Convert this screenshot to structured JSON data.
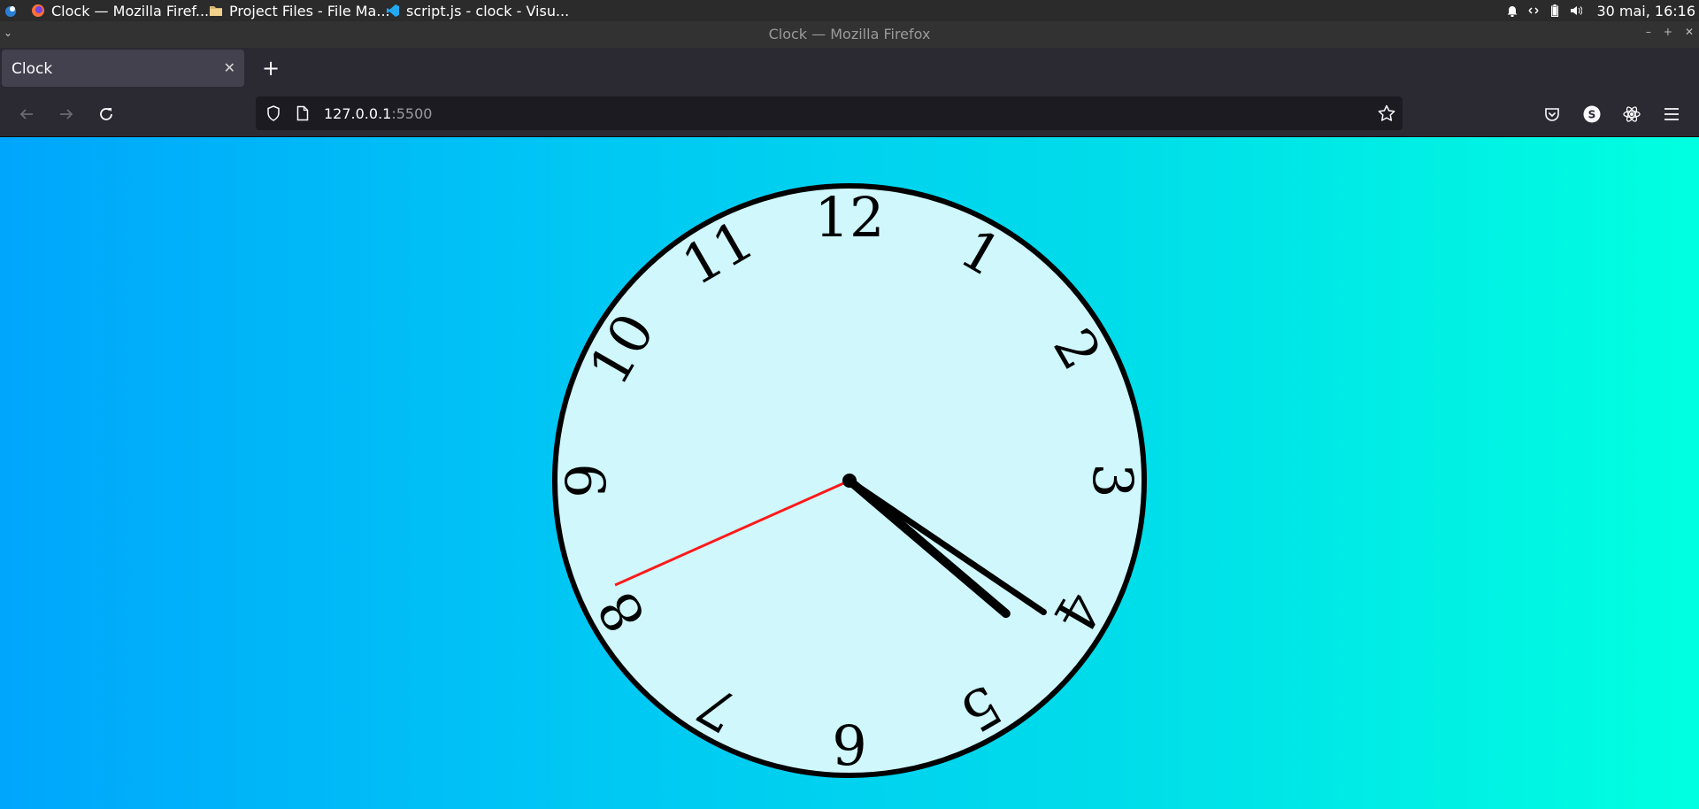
{
  "taskbar": {
    "tasks": [
      {
        "label": "Clock — Mozilla Firef...",
        "icon": "firefox-icon"
      },
      {
        "label": "Project Files - File Ma...",
        "icon": "folder-icon"
      },
      {
        "label": "script.js - clock - Visu...",
        "icon": "vscode-icon"
      }
    ],
    "datetime": "30 mai, 16:16"
  },
  "window": {
    "title": "Clock — Mozilla Firefox"
  },
  "tabs": [
    {
      "label": "Clock"
    }
  ],
  "address": {
    "host": "127.0.0.1",
    "port": ":5500"
  },
  "clock": {
    "numerals": [
      "12",
      "1",
      "2",
      "3",
      "4",
      "5",
      "6",
      "7",
      "8",
      "9",
      "10",
      "11"
    ],
    "time": {
      "hours": 4,
      "minutes": 20,
      "seconds": 41
    },
    "face_color": "#cff7fc",
    "hand_color": "#000000",
    "second_hand_color": "#ff1a1a"
  },
  "colors": {
    "gradient_start": "#00a6fc",
    "gradient_end": "#00ffe0"
  }
}
